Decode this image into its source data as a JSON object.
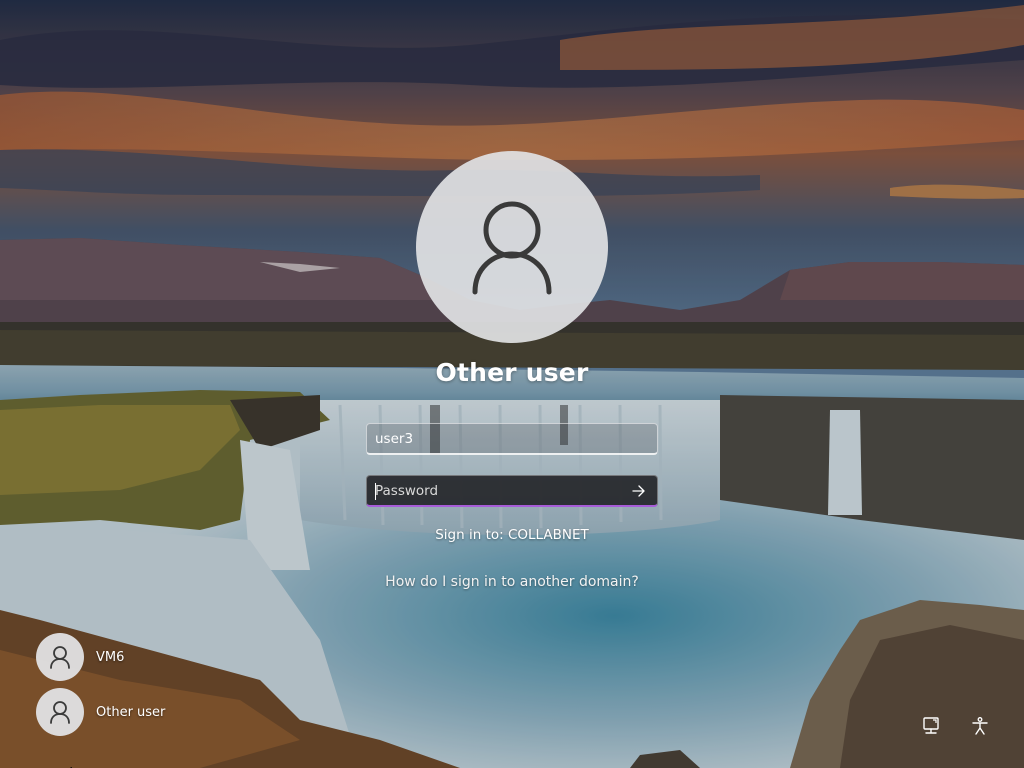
{
  "login": {
    "title": "Other user",
    "username_value": "user3",
    "password_placeholder": "Password",
    "signin_domain_text": "Sign in to: COLLABNET",
    "other_domain_link": "How do I sign in to another domain?"
  },
  "user_list": [
    {
      "name": "VM6",
      "icon": "user-avatar-icon"
    },
    {
      "name": "Other user",
      "icon": "user-avatar-icon"
    }
  ],
  "system_tray": {
    "network_icon": "network-icon",
    "accessibility_icon": "accessibility-icon"
  },
  "colors": {
    "focus_underline": "#a75cd8",
    "text": "#ffffff"
  }
}
